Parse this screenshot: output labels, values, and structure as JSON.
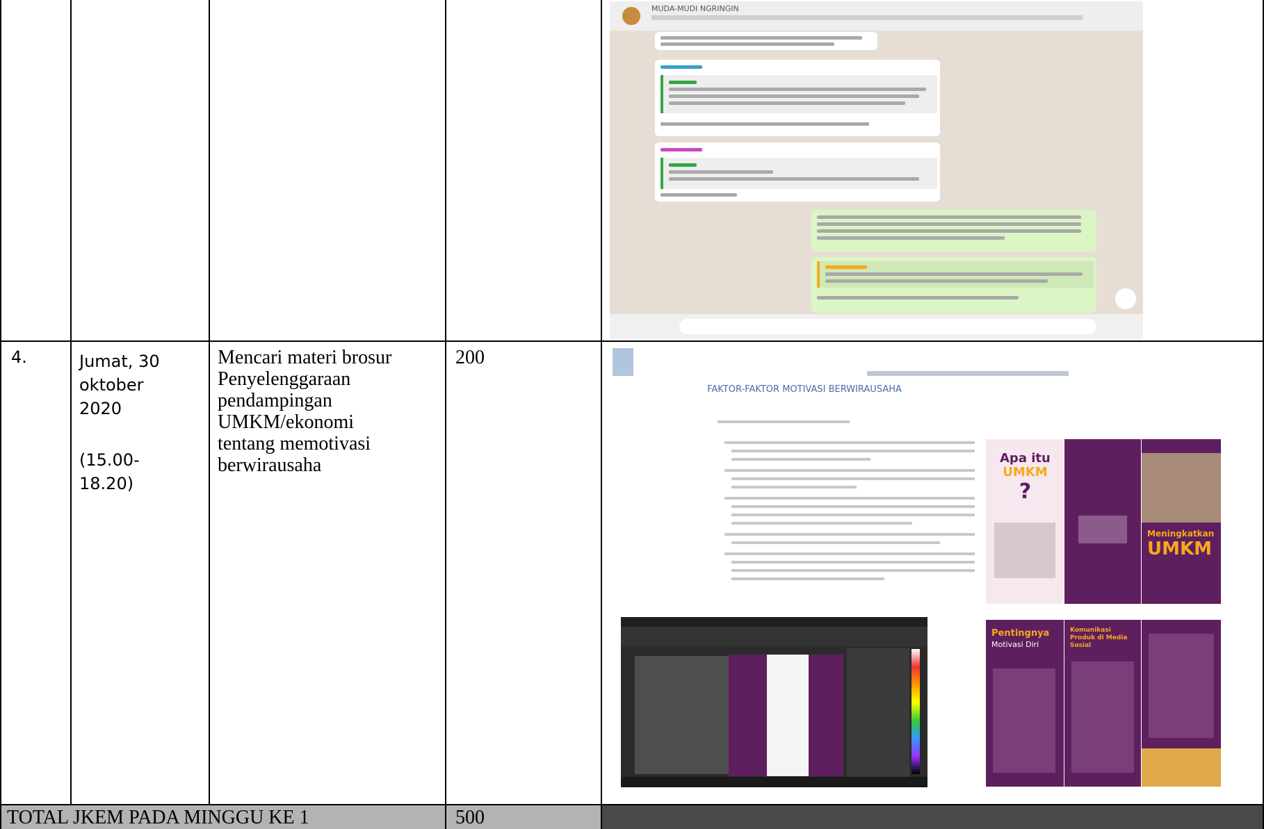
{
  "table": {
    "row_4": {
      "number": "4.",
      "date_line1": "Jumat, 30",
      "date_line2": "oktober",
      "date_line3": "2020",
      "time_line1": "(15.00-",
      "time_line2": "18.20)",
      "activity_line1": "Mencari materi brosur",
      "activity_line2": "Penyelenggaraan",
      "activity_line3": "pendampingan",
      "activity_line4": "UMKM/ekonomi",
      "activity_line5": "tentang memotivasi",
      "activity_line6": "berwirausaha",
      "jkem": "200"
    },
    "total": {
      "label": "TOTAL JKEM PADA MINGGU KE 1",
      "value": "500"
    }
  },
  "chat_screenshot": {
    "title": "MUDA-MUDI NGRINGIN"
  },
  "web_screenshot": {
    "heading": "FAKTOR-FAKTOR MOTIVASI BERWIRAUSAHA"
  },
  "brochure": {
    "cover_question_line1": "Apa itu",
    "cover_question_line2": "UMKM",
    "cover_question_mark": "?",
    "cover_title_line1": "Meningkatkan",
    "cover_title_line2": "UMKM",
    "inner_title_line1": "Pentingnya",
    "inner_title_line2": "Motivasi Diri",
    "inner_subtitle": "Komunikasi Produk di Media Sosial"
  },
  "colors": {
    "brochure_purple": "#5e1f5f",
    "brochure_yellow": "#f6a91c",
    "total_row": "#b3b3b3"
  }
}
